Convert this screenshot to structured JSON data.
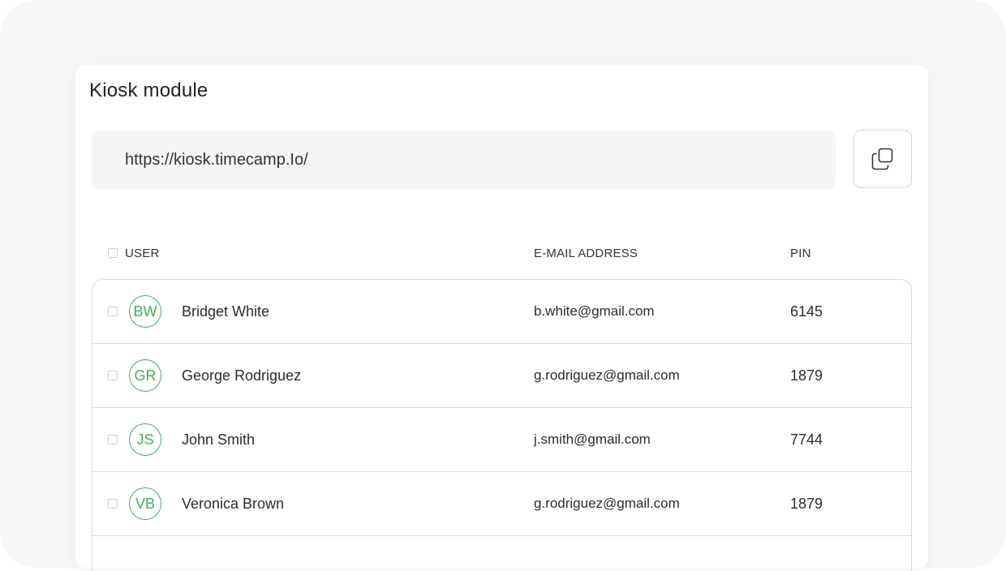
{
  "card": {
    "title": "Kiosk module",
    "url_value": "https://kiosk.timecamp.Io/"
  },
  "table": {
    "headers": {
      "user": "USER",
      "email": "E-MAIL ADDRESS",
      "pin": "PIN"
    },
    "rows": [
      {
        "initials": "BW",
        "name": "Bridget White",
        "email": "b.white@gmail.com",
        "pin": "6145"
      },
      {
        "initials": "GR",
        "name": "George Rodriguez",
        "email": "g.rodriguez@gmail.com",
        "pin": "1879"
      },
      {
        "initials": "JS",
        "name": "John Smith",
        "email": "j.smith@gmail.com",
        "pin": "7744"
      },
      {
        "initials": "VB",
        "name": "Veronica Brown",
        "email": "g.rodriguez@gmail.com",
        "pin": "1879"
      }
    ]
  },
  "colors": {
    "accent_green": "#3fae5a",
    "url_background": "#f5f5f5",
    "frame_background": "#f6f7f8"
  },
  "icons": {
    "copy_button": "copy-icon"
  }
}
